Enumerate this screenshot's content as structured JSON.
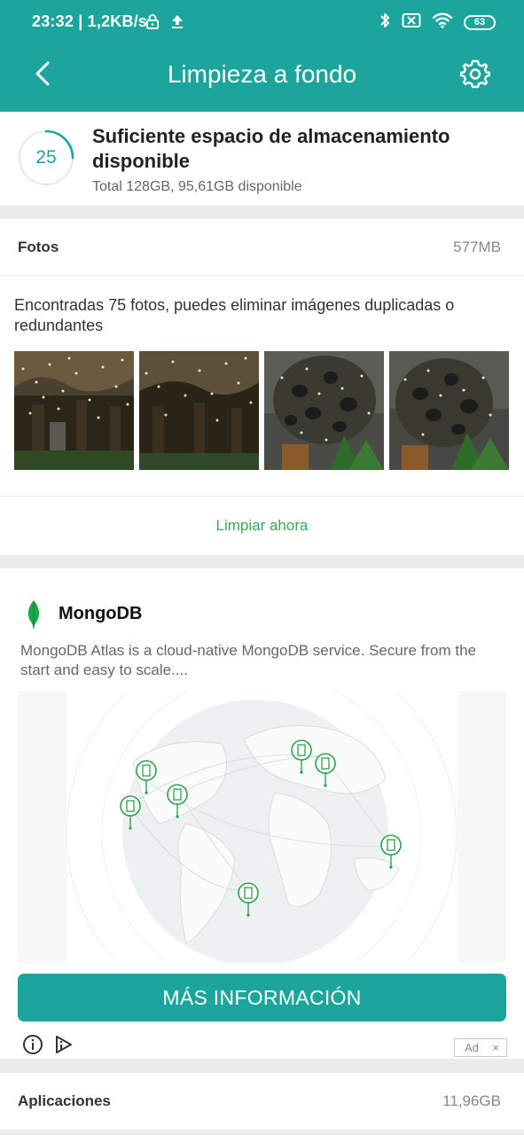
{
  "status_bar": {
    "time_speed": "23:32 | 1,2KB/s",
    "battery": "63",
    "icons": [
      "lock-icon",
      "upload-icon",
      "bluetooth-icon",
      "sim-disabled-icon",
      "wifi-icon",
      "battery-icon"
    ]
  },
  "app_bar": {
    "title": "Limpieza a fondo",
    "back_icon": "back-arrow-icon",
    "settings_icon": "gear-icon"
  },
  "storage": {
    "score": "25",
    "score_progress": 0.25,
    "title": "Suficiente espacio de almacenamiento disponible",
    "subtitle": "Total 128GB, 95,61GB disponible"
  },
  "photos": {
    "label": "Fotos",
    "size": "577MB",
    "description": "Encontradas 75 fotos, puedes eliminar imágenes duplicadas o redundantes",
    "action": "Limpiar ahora"
  },
  "ad": {
    "brand": "MongoDB",
    "text": "MongoDB Atlas is a cloud-native MongoDB service. Secure from the start and easy to scale....",
    "cta": "MÁS INFORMACIÓN",
    "badge": "Ad",
    "badge_close": "×"
  },
  "apps": {
    "label": "Aplicaciones",
    "size": "11,96GB"
  },
  "colors": {
    "primary": "#1ba59c",
    "action_green": "#3aa657",
    "background": "#ebebeb"
  }
}
